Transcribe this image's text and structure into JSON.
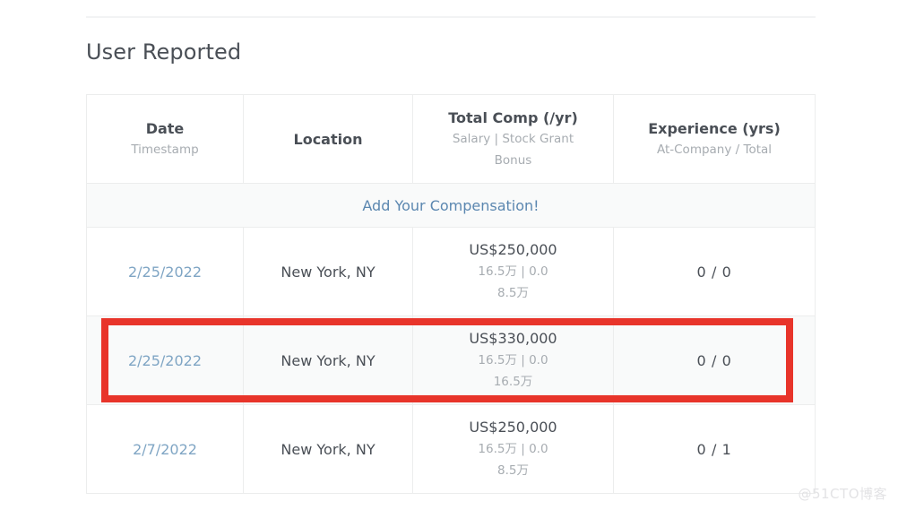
{
  "section": {
    "title": "User Reported"
  },
  "table": {
    "columns": [
      {
        "main": "Date",
        "sub": "Timestamp",
        "sub2": ""
      },
      {
        "main": "Location",
        "sub": "",
        "sub2": ""
      },
      {
        "main": "Total Comp (/yr)",
        "sub": "Salary | Stock Grant",
        "sub2": "Bonus"
      },
      {
        "main": "Experience (yrs)",
        "sub": "At-Company / Total",
        "sub2": ""
      }
    ],
    "add_row_label": "Add Your Compensation!",
    "rows": [
      {
        "date": "2/25/2022",
        "location": "New York, NY",
        "comp_total": "US$250,000",
        "comp_line1": "16.5万 | 0.0",
        "comp_line2": "8.5万",
        "experience": "0 / 0",
        "highlighted": false
      },
      {
        "date": "2/25/2022",
        "location": "New York, NY",
        "comp_total": "US$330,000",
        "comp_line1": "16.5万 | 0.0",
        "comp_line2": "16.5万",
        "experience": "0 / 0",
        "highlighted": true
      },
      {
        "date": "2/7/2022",
        "location": "New York, NY",
        "comp_total": "US$250,000",
        "comp_line1": "16.5万 | 0.0",
        "comp_line2": "8.5万",
        "experience": "0 / 1",
        "highlighted": false
      }
    ]
  },
  "annotation": {
    "highlight_color": "#e8342a"
  },
  "watermark": {
    "text": "@51CTO博客"
  }
}
